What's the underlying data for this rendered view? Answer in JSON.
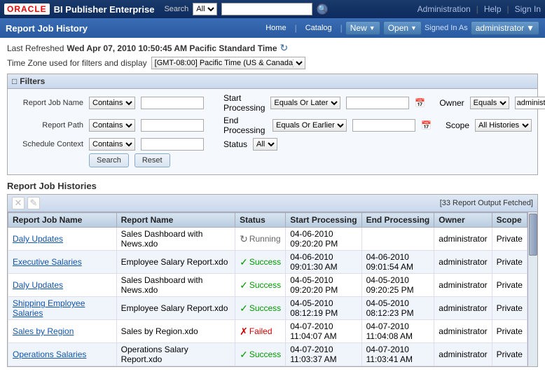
{
  "oracle": {
    "logo": "ORACLE",
    "bi_title": "BI Publisher Enterprise",
    "search_label": "Search",
    "search_option": "All",
    "nav_right": {
      "administration": "Administration",
      "help": "Help",
      "sign_in": "Sign In"
    }
  },
  "second_bar": {
    "title": "Report Job History",
    "home": "Home",
    "catalog": "Catalog",
    "new_btn": "New",
    "open_btn": "Open",
    "signed_in_label": "Signed In As",
    "user": "administrator"
  },
  "refresh": {
    "label": "Last Refreshed",
    "date": "Wed Apr 07, 2010 10:50:45 AM Pacific Standard Time"
  },
  "timezone": {
    "label": "Time Zone used for filters and display",
    "value": "[GMT-08:00] Pacific Time (US & Canada)"
  },
  "filters": {
    "title": "Filters",
    "rows": [
      {
        "label": "Report Job Name",
        "condition": "Contains",
        "value": ""
      },
      {
        "label": "Report Path",
        "condition": "Contains",
        "value": ""
      },
      {
        "label": "Schedule Context",
        "condition": "Contains",
        "value": ""
      }
    ],
    "processing": {
      "start_label": "Start Processing",
      "start_cond": "Equals Or Later",
      "start_val": "",
      "end_label": "End Processing",
      "end_cond": "Equals Or Earlier",
      "end_val": "",
      "status_label": "Status",
      "status_val": "All"
    },
    "right": {
      "owner_label": "Owner",
      "owner_cond": "Equals",
      "owner_val": "administrator",
      "scope_label": "Scope",
      "scope_val": "All Histories"
    },
    "search_btn": "Search",
    "reset_btn": "Reset"
  },
  "histories": {
    "title": "Report Job Histories",
    "fetched_msg": "[33 Report Output Fetched]",
    "columns": [
      "Report Job Name",
      "Report Name",
      "Status",
      "Start Processing",
      "End Processing",
      "Owner",
      "Scope"
    ],
    "rows": [
      {
        "job_name": "Daly Updates",
        "report_name": "Sales Dashboard with News.xdo",
        "status": "Running",
        "status_type": "running",
        "start": "04-06-2010\n09:20:20 PM",
        "end": "",
        "owner": "administrator",
        "scope": "Private"
      },
      {
        "job_name": "Executive Salaries",
        "report_name": "Employee Salary Report.xdo",
        "status": "Success",
        "status_type": "success",
        "start": "04-06-2010\n09:01:30 AM",
        "end": "04-06-2010\n09:01:54 AM",
        "owner": "administrator",
        "scope": "Private"
      },
      {
        "job_name": "Daly Updates",
        "report_name": "Sales Dashboard with News.xdo",
        "status": "Success",
        "status_type": "success",
        "start": "04-05-2010\n09:20:20 PM",
        "end": "04-05-2010\n09:20:25 PM",
        "owner": "administrator",
        "scope": "Private"
      },
      {
        "job_name": "Shipping Employee Salaries",
        "report_name": "Employee Salary Report.xdo",
        "status": "Success",
        "status_type": "success",
        "start": "04-05-2010\n08:12:19 PM",
        "end": "04-05-2010\n08:12:23 PM",
        "owner": "administrator",
        "scope": "Private"
      },
      {
        "job_name": "Sales by Region",
        "report_name": "Sales by Region.xdo",
        "status": "Failed",
        "status_type": "failed",
        "start": "04-07-2010\n11:04:07 AM",
        "end": "04-07-2010\n11:04:08 AM",
        "owner": "administrator",
        "scope": "Private"
      },
      {
        "job_name": "Operations Salaries",
        "report_name": "Operations Salary Report.xdo",
        "status": "Success",
        "status_type": "success",
        "start": "04-07-2010\n11:03:37 AM",
        "end": "04-07-2010\n11:03:41 AM",
        "owner": "administrator",
        "scope": "Private"
      }
    ]
  }
}
